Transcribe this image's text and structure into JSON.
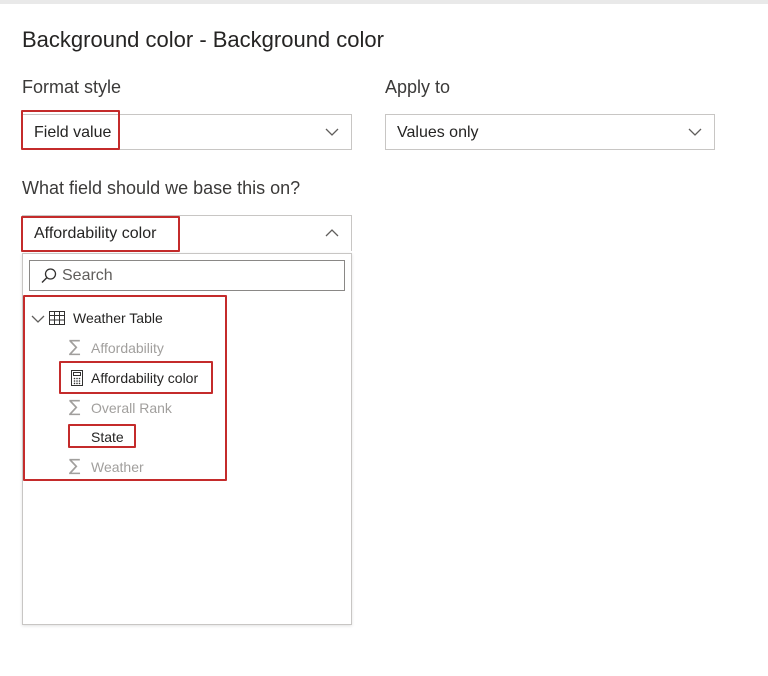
{
  "title": "Background color - Background color",
  "format_style": {
    "label": "Format style",
    "value": "Field value"
  },
  "apply_to": {
    "label": "Apply to",
    "value": "Values only"
  },
  "base_field": {
    "label": "What field should we base this on?",
    "value": "Affordability color"
  },
  "dropdown": {
    "search_placeholder": "Search",
    "table": {
      "name": "Weather Table",
      "icon": "table-icon",
      "fields": [
        {
          "name": "Affordability",
          "icon": "sigma-icon",
          "enabled": false
        },
        {
          "name": "Affordability color",
          "icon": "calculator-icon",
          "enabled": true,
          "selected": true
        },
        {
          "name": "Overall Rank",
          "icon": "sigma-icon",
          "enabled": false
        },
        {
          "name": "State",
          "icon": "none",
          "enabled": true
        },
        {
          "name": "Weather",
          "icon": "sigma-icon",
          "enabled": false
        }
      ]
    }
  },
  "colors": {
    "highlight_box": "#c42b2b",
    "disabled_text": "#a19f9d",
    "border": "#c8c6c4"
  }
}
